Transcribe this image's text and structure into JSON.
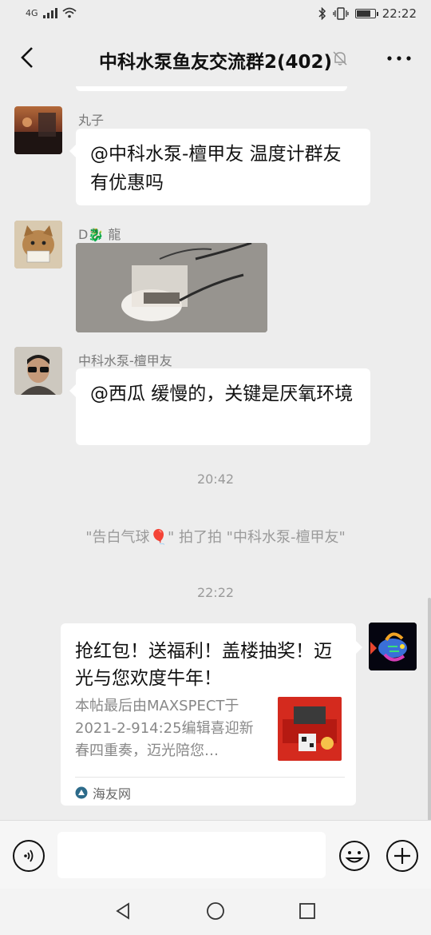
{
  "status_bar": {
    "network": "4G",
    "time": "22:22",
    "battery_level": 0.72
  },
  "header": {
    "title": "中科水泵鱼友交流群2(402)"
  },
  "messages": [
    {
      "sender": "丸子",
      "text": "@中科水泵-檀甲友  温度计群友有优惠吗"
    },
    {
      "sender": "D🐉 龍",
      "type": "image"
    },
    {
      "sender": "中科水泵-檀甲友",
      "text": "@西瓜  缓慢的，关键是厌氧环境"
    }
  ],
  "timestamp_1": "20:42",
  "system_message": "\"告白气球🎈\" 拍了拍 \"中科水泵-檀甲友\"",
  "timestamp_2": "22:22",
  "link_card": {
    "title": "抢红包！送福利！盖楼抽奖！迈光与您欢度牛年！",
    "description": "本帖最后由MAXSPECT于2021-2-914:25编辑喜迎新春四重奏，迈光陪您…",
    "source": "海友网"
  },
  "colors": {
    "background": "#ededed",
    "bubble": "#ffffff",
    "meta_text": "#9a9a9a"
  }
}
